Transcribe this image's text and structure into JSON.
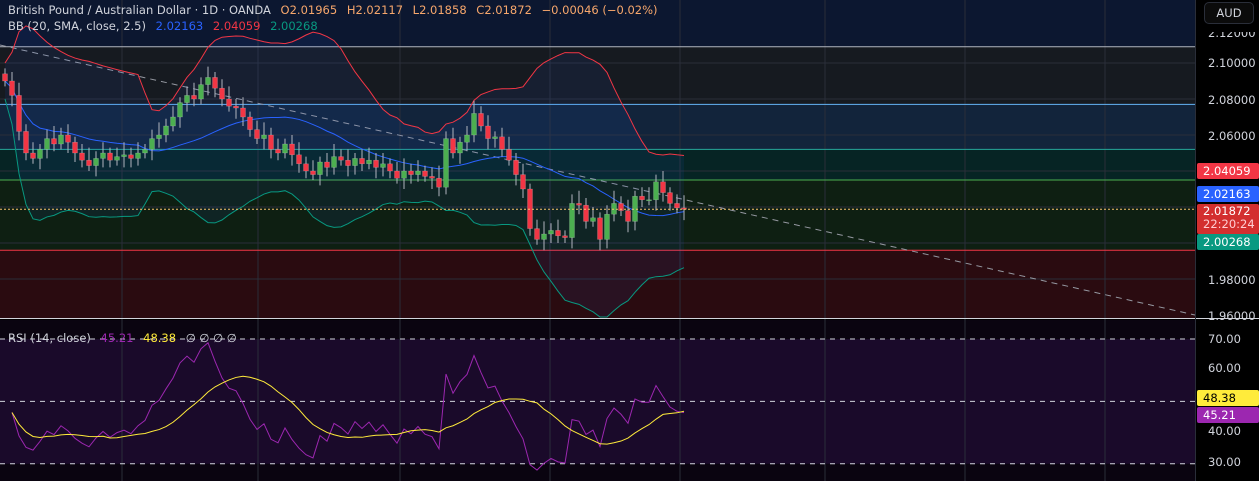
{
  "header": {
    "symbol": "British Pound / Australian Dollar · 1D · OANDA",
    "open": "O2.01965",
    "high": "H2.02117",
    "low": "L2.01858",
    "close": "C2.01872",
    "change": "−0.00046 (−0.02%)"
  },
  "bb": {
    "label": "BB (20, SMA, close, 2.5)",
    "basis": "2.02163",
    "upper": "2.04059",
    "lower": "2.00268"
  },
  "rsi": {
    "label": "RSI (14, close)",
    "value": "45.21",
    "ma": "48.38",
    "extras": "∅ ∅ ∅ ∅"
  },
  "axis": {
    "currency": "AUD",
    "price_ticks": [
      "2.12000",
      "2.10000",
      "2.08000",
      "2.06000",
      "1.98000",
      "1.96000"
    ],
    "rsi_ticks": [
      "70.00",
      "60.00",
      "40.00",
      "30.00"
    ],
    "tags": {
      "upper": "2.04059",
      "basis": "2.02163",
      "last": "2.01872",
      "countdown": "22:20:24",
      "lower": "2.00268",
      "rsi_ma": "48.38",
      "rsi": "45.21"
    }
  },
  "colors": {
    "up": "#4caf50",
    "down": "#f23645",
    "basis": "#2962ff",
    "upper": "#f23645",
    "lower": "#089981",
    "rsi": "#9c27b0",
    "rsi_ma": "#ffeb3b"
  },
  "chart_data": {
    "type": "candlestick",
    "title": "British Pound / Australian Dollar · 1D · OANDA",
    "ylabel": "AUD",
    "ylim": [
      1.96,
      2.12
    ],
    "closes": [
      2.09,
      2.082,
      2.062,
      2.05,
      2.047,
      2.052,
      2.058,
      2.055,
      2.06,
      2.056,
      2.05,
      2.046,
      2.043,
      2.047,
      2.05,
      2.046,
      2.048,
      2.049,
      2.047,
      2.05,
      2.052,
      2.058,
      2.06,
      2.065,
      2.07,
      2.078,
      2.082,
      2.08,
      2.088,
      2.092,
      2.086,
      2.08,
      2.076,
      2.075,
      2.07,
      2.063,
      2.058,
      2.06,
      2.052,
      2.05,
      2.055,
      2.049,
      2.044,
      2.04,
      2.038,
      2.045,
      2.042,
      2.048,
      2.046,
      2.043,
      2.047,
      2.044,
      2.046,
      2.042,
      2.044,
      2.04,
      2.036,
      2.04,
      2.038,
      2.04,
      2.037,
      2.036,
      2.031,
      2.058,
      2.05,
      2.056,
      2.06,
      2.072,
      2.065,
      2.058,
      2.059,
      2.052,
      2.046,
      2.038,
      2.03,
      2.008,
      2.002,
      2.005,
      2.007,
      2.004,
      2.003,
      2.022,
      2.021,
      2.012,
      2.014,
      2.002,
      2.016,
      2.022,
      2.018,
      2.012,
      2.026,
      2.024,
      2.024,
      2.034,
      2.028,
      2.022,
      2.0195,
      2.01872
    ],
    "levels": [
      2.109,
      2.077,
      2.052,
      2.035,
      1.996
    ],
    "trendline": [
      2.11,
      1.96
    ],
    "rsi_ylim": [
      25,
      75
    ]
  }
}
